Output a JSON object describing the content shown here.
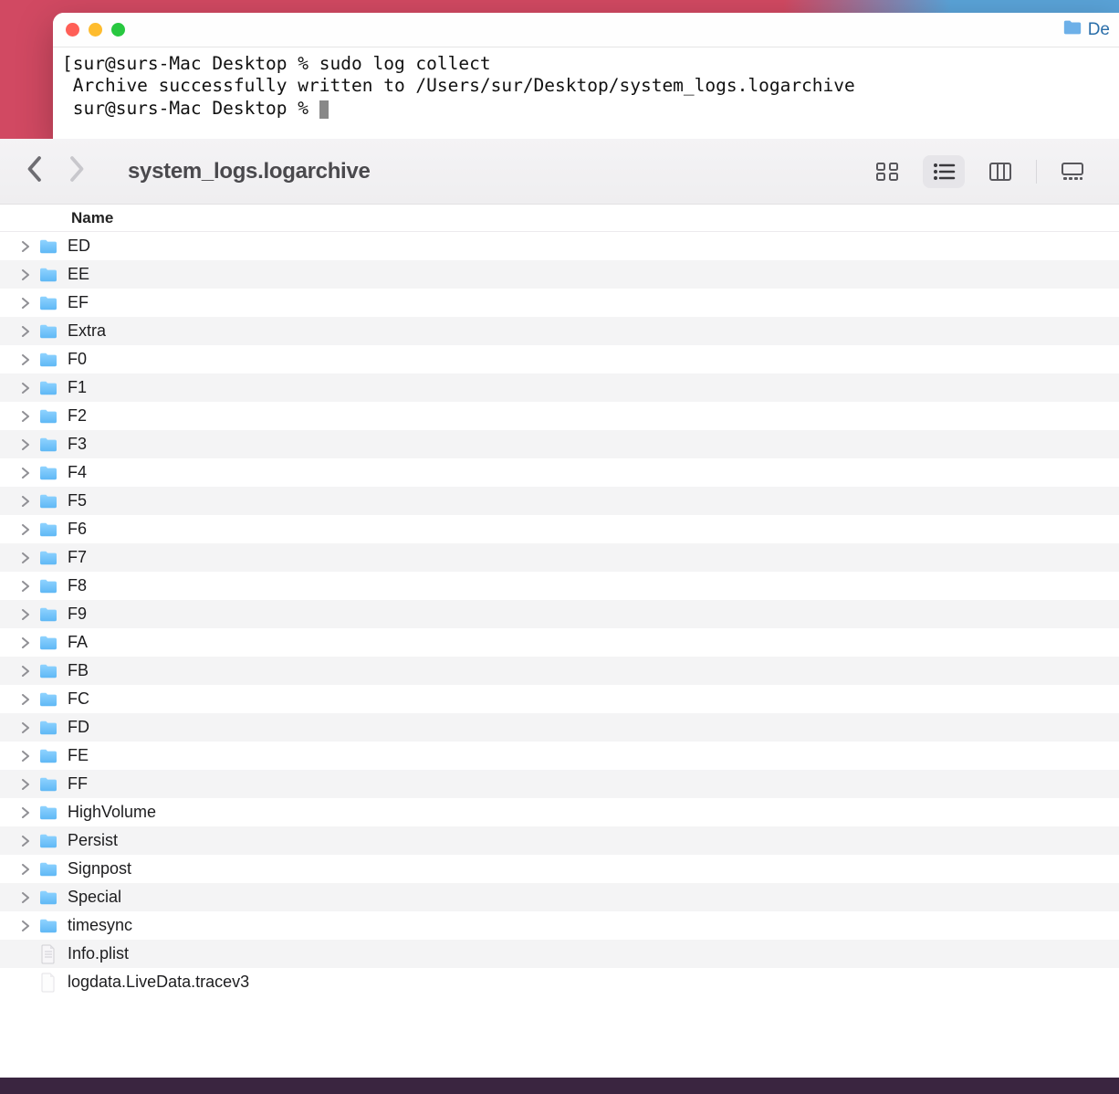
{
  "terminal": {
    "titlebar_right_label": "De",
    "lines": [
      "[sur@surs-Mac Desktop % sudo log collect",
      " Archive successfully written to /Users/sur/Desktop/system_logs.logarchive",
      " sur@surs-Mac Desktop % "
    ]
  },
  "finder": {
    "title": "system_logs.logarchive",
    "column_header": "Name",
    "items": [
      {
        "name": "ED",
        "type": "folder"
      },
      {
        "name": "EE",
        "type": "folder"
      },
      {
        "name": "EF",
        "type": "folder"
      },
      {
        "name": "Extra",
        "type": "folder"
      },
      {
        "name": "F0",
        "type": "folder"
      },
      {
        "name": "F1",
        "type": "folder"
      },
      {
        "name": "F2",
        "type": "folder"
      },
      {
        "name": "F3",
        "type": "folder"
      },
      {
        "name": "F4",
        "type": "folder"
      },
      {
        "name": "F5",
        "type": "folder"
      },
      {
        "name": "F6",
        "type": "folder"
      },
      {
        "name": "F7",
        "type": "folder"
      },
      {
        "name": "F8",
        "type": "folder"
      },
      {
        "name": "F9",
        "type": "folder"
      },
      {
        "name": "FA",
        "type": "folder"
      },
      {
        "name": "FB",
        "type": "folder"
      },
      {
        "name": "FC",
        "type": "folder"
      },
      {
        "name": "FD",
        "type": "folder"
      },
      {
        "name": "FE",
        "type": "folder"
      },
      {
        "name": "FF",
        "type": "folder"
      },
      {
        "name": "HighVolume",
        "type": "folder"
      },
      {
        "name": "Persist",
        "type": "folder"
      },
      {
        "name": "Signpost",
        "type": "folder"
      },
      {
        "name": "Special",
        "type": "folder"
      },
      {
        "name": "timesync",
        "type": "folder"
      },
      {
        "name": "Info.plist",
        "type": "plist"
      },
      {
        "name": "logdata.LiveData.tracev3",
        "type": "file"
      }
    ]
  }
}
